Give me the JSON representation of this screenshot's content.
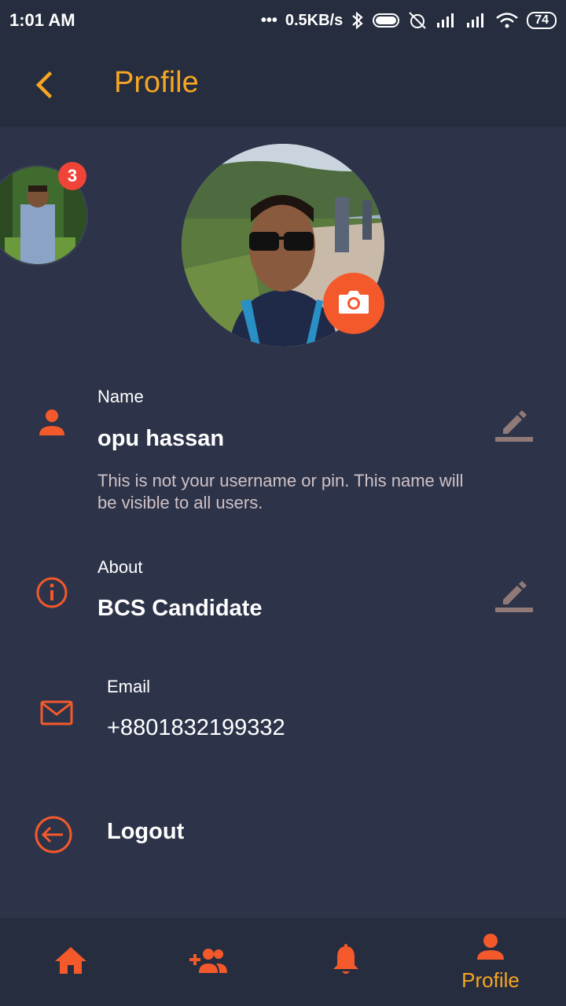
{
  "status_bar": {
    "time": "1:01 AM",
    "dots": "•••",
    "speed": "0.5KB/s",
    "battery": "74"
  },
  "app_bar": {
    "back_icon": "chevron-left-icon",
    "title": "Profile"
  },
  "mini_avatar": {
    "badge_count": "3"
  },
  "profile": {
    "camera_icon": "camera-icon",
    "name": {
      "label": "Name",
      "value": "opu hassan",
      "helper": "This is not your username or pin. This name will be visible to all users."
    },
    "about": {
      "label": "About",
      "value": "BCS Candidate"
    },
    "email": {
      "label": "Email",
      "value": "+8801832199332"
    },
    "logout": {
      "label": "Logout"
    }
  },
  "bottom_nav": {
    "items": [
      {
        "icon": "home-icon",
        "label": ""
      },
      {
        "icon": "add-friends-icon",
        "label": ""
      },
      {
        "icon": "bell-icon",
        "label": ""
      },
      {
        "icon": "person-icon",
        "label": "Profile"
      }
    ]
  },
  "colors": {
    "background": "#2d3449",
    "bar": "#262d3e",
    "accent_orange": "#f4592b",
    "title_yellow": "#f6a623",
    "edit_grey": "#8f7a78"
  }
}
